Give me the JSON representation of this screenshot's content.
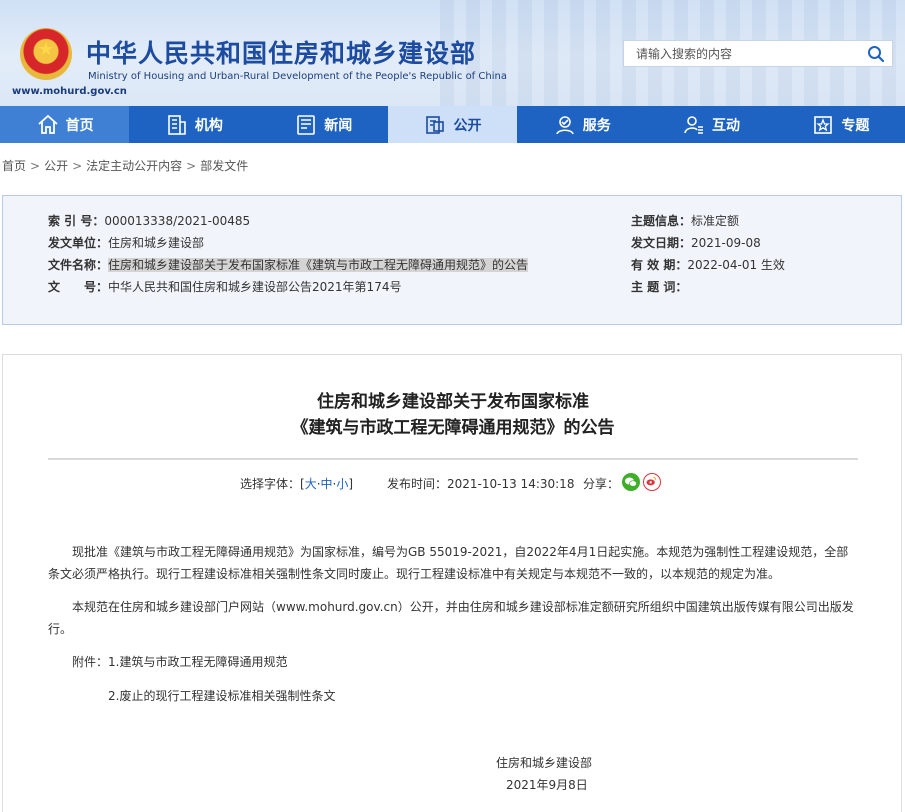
{
  "header": {
    "title": "中华人民共和国住房和城乡建设部",
    "subtitle": "Ministry of Housing and Urban-Rural Development of the People's Republic of China",
    "url": "www.mohurd.gov.cn",
    "emblem_icon": "national-emblem-icon",
    "search_placeholder": "请输入搜索的内容"
  },
  "nav": {
    "items": [
      {
        "label": "首页",
        "icon": "home-icon",
        "active": true
      },
      {
        "label": "机构",
        "icon": "building-icon"
      },
      {
        "label": "新闻",
        "icon": "news-icon"
      },
      {
        "label": "公开",
        "icon": "document-icon",
        "active": true
      },
      {
        "label": "服务",
        "icon": "service-icon"
      },
      {
        "label": "互动",
        "icon": "interaction-icon"
      },
      {
        "label": "专题",
        "icon": "topic-icon"
      }
    ],
    "colors": {
      "bar": "#1e63c1",
      "active": "#cde0f7"
    }
  },
  "breadcrumb": [
    "首页",
    "公开",
    "法定主动公开内容",
    "部发文件"
  ],
  "info": {
    "index_label": "索 引 号：",
    "index_value": "000013338/2021-00485",
    "issuer_label": "发文单位：",
    "issuer_value": "住房和城乡建设部",
    "name_label": "文件名称：",
    "name_value": "住房和城乡建设部关于发布国家标准《建筑与市政工程无障碍通用规范》的公告",
    "doc_label": "文　　号：",
    "doc_value": "中华人民共和国住房和城乡建设部公告2021年第174号",
    "topic_label": "主题信息：",
    "topic_value": "标准定额",
    "date_label": "发文日期：",
    "date_value": "2021-09-08",
    "valid_label": "有 效 期：",
    "valid_value": "2022-04-01 生效",
    "keywords_label": "主 题 词：",
    "keywords_value": ""
  },
  "article": {
    "title_line1": "住房和城乡建设部关于发布国家标准",
    "title_line2": "《建筑与市政工程无障碍通用规范》的公告",
    "font_label": "选择字体：[",
    "font_large": "大",
    "font_medium": "中",
    "font_small": "小",
    "font_end": "]",
    "publish_time": "发布时间：2021-10-13 14:30:18",
    "share_label": "分享：",
    "share_wechat_icon": "wechat-icon",
    "share_weibo_icon": "weibo-icon",
    "paragraph1": "现批准《建筑与市政工程无障碍通用规范》为国家标准，编号为GB 55019-2021，自2022年4月1日起实施。本规范为强制性工程建设规范，全部条文必须严格执行。现行工程建设标准相关强制性条文同时废止。现行工程建设标准中有关规定与本规范不一致的，以本规范的规定为准。",
    "paragraph2": "本规范在住房和城乡建设部门户网站（www.mohurd.gov.cn）公开，并由住房和城乡建设部标准定额研究所组织中国建筑出版传媒有限公司出版发行。",
    "attachment1": "附件：1.建筑与市政工程无障碍通用规范",
    "attachment2": "2.废止的现行工程建设标准相关强制性条文",
    "sign_org": "住房和城乡建设部",
    "sign_date": "2021年9月8日"
  }
}
